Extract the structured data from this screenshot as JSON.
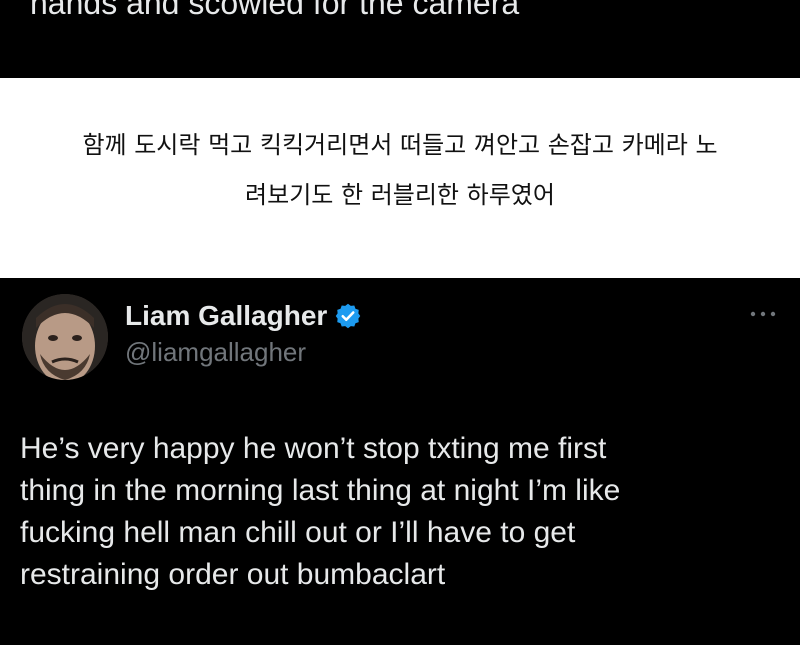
{
  "top_block": {
    "caption": "hands and scowled for the camera"
  },
  "korean_caption": {
    "lines": [
      "함께 도시락 먹고 킥킥거리면서 떠들고 껴안고 손잡고 카메라 노",
      "려보기도 한 러블리한 하루였어"
    ]
  },
  "tweet": {
    "author": {
      "display_name": "Liam Gallagher",
      "handle": "@liamgallagher",
      "verified": true,
      "verified_color": "#1d9bf0"
    },
    "avatar_icon": "profile-photo",
    "more_icon": "ellipsis-icon",
    "text_lines": [
      "He’s very happy he won’t stop txting me first",
      "thing in the morning last thing at night I’m like",
      "fucking hell man chill out or I’ll have to get",
      "restraining order out bumbaclart"
    ]
  },
  "colors": {
    "background": "#ffffff",
    "card_background": "#000000",
    "primary_text": "#e7e9ea",
    "secondary_text": "#71767b",
    "caption_text": "#111111"
  }
}
